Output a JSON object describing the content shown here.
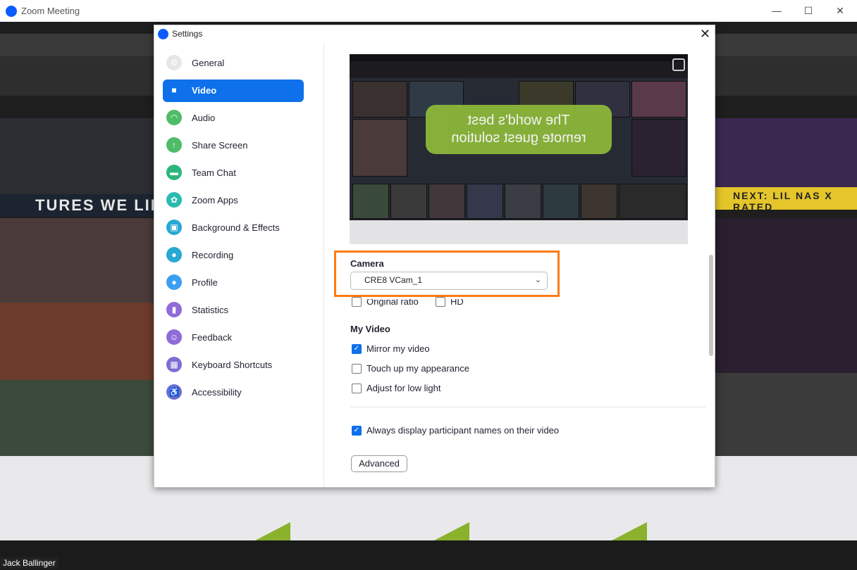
{
  "window": {
    "title": "Zoom Meeting",
    "controls": [
      "—",
      "☐",
      "✕"
    ]
  },
  "background": {
    "participant_name": "Jack Ballinger",
    "marquee_left": "TURES WE LIKE",
    "marquee_right": "NEXT: LIL NAS X RATED"
  },
  "settings": {
    "title": "Settings",
    "close_label": "✕",
    "sidebar": {
      "items": [
        {
          "label": "General",
          "icon": "gear-icon",
          "color": "#e7e7ea"
        },
        {
          "label": "Video",
          "icon": "video-camera-icon",
          "color": "#0e71eb",
          "active": true
        },
        {
          "label": "Audio",
          "icon": "headphones-icon",
          "color": "#4fbc68"
        },
        {
          "label": "Share Screen",
          "icon": "share-screen-icon",
          "color": "#4fbc68"
        },
        {
          "label": "Team Chat",
          "icon": "chat-icon",
          "color": "#2cb57c"
        },
        {
          "label": "Zoom Apps",
          "icon": "apps-icon",
          "color": "#2bbab0"
        },
        {
          "label": "Background & Effects",
          "icon": "background-icon",
          "color": "#29a8d3"
        },
        {
          "label": "Recording",
          "icon": "recording-icon",
          "color": "#29a8d3"
        },
        {
          "label": "Profile",
          "icon": "profile-icon",
          "color": "#3a9ff1"
        },
        {
          "label": "Statistics",
          "icon": "statistics-icon",
          "color": "#8f6bd9"
        },
        {
          "label": "Feedback",
          "icon": "feedback-icon",
          "color": "#8f6bd9"
        },
        {
          "label": "Keyboard Shortcuts",
          "icon": "keyboard-icon",
          "color": "#7c6fd3"
        },
        {
          "label": "Accessibility",
          "icon": "accessibility-icon",
          "color": "#6f6fd3"
        }
      ]
    },
    "video": {
      "preview_caption_line1": "The world's best",
      "preview_caption_line2": "remote guest solution",
      "camera_label": "Camera",
      "camera_value": "CRE8 VCam_1",
      "original_ratio_label": "Original ratio",
      "hd_label": "HD",
      "my_video_heading": "My Video",
      "mirror_label": "Mirror my video",
      "mirror_checked": true,
      "touch_up_label": "Touch up my appearance",
      "touch_up_checked": false,
      "low_light_label": "Adjust for low light",
      "low_light_checked": false,
      "display_names_label": "Always display participant names on their video",
      "display_names_checked": true,
      "advanced_label": "Advanced"
    },
    "highlight_color": "#ff7a12"
  }
}
